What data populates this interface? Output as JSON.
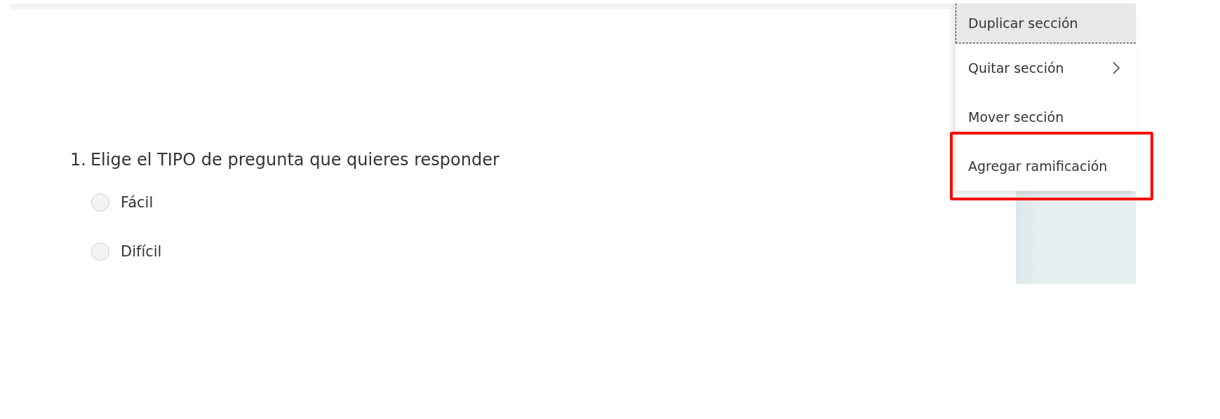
{
  "question": {
    "number": "1.",
    "text": "Elige el TIPO de pregunta que quieres responder",
    "options": [
      {
        "label": "Fácil",
        "selected": false
      },
      {
        "label": "Difícil",
        "selected": false
      }
    ]
  },
  "menu": {
    "items": [
      {
        "label": "Duplicar sección",
        "selected": true,
        "submenu": false,
        "annotated": false
      },
      {
        "label": "Quitar sección",
        "selected": false,
        "submenu": true,
        "annotated": false
      },
      {
        "label": "Mover sección",
        "selected": false,
        "submenu": false,
        "annotated": false
      },
      {
        "label": "Agregar ramificación",
        "selected": false,
        "submenu": false,
        "annotated": true
      }
    ]
  }
}
